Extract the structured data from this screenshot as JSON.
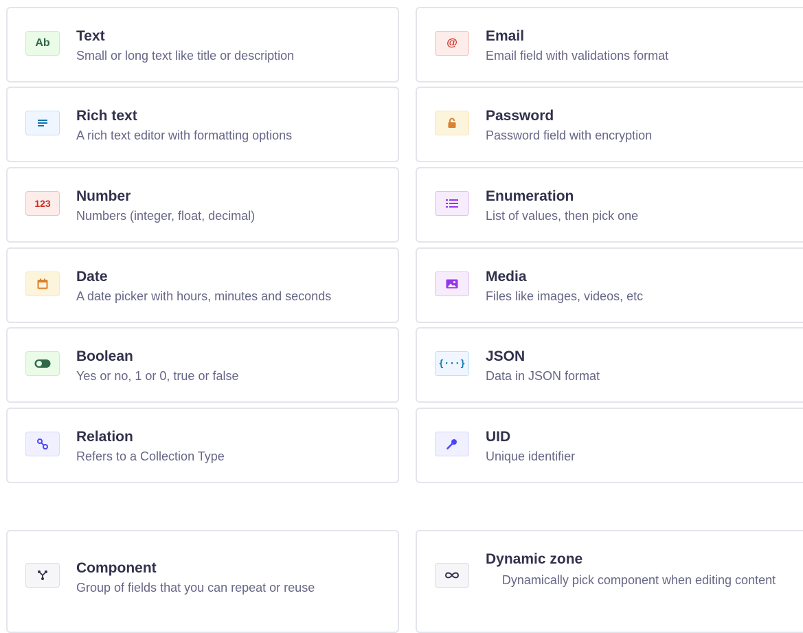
{
  "fields": [
    {
      "key": "text",
      "title": "Text",
      "description": "Small or long text like title or description",
      "icon_text": "Ab",
      "icon": "text-icon",
      "color": "#2f6846"
    },
    {
      "key": "email",
      "title": "Email",
      "description": "Email field with validations format",
      "icon_text": "@",
      "icon": "email-icon",
      "color": "#d02b20"
    },
    {
      "key": "rich-text",
      "title": "Rich text",
      "description": "A rich text editor with formatting options",
      "icon": "rich-text-icon",
      "color": "#0c75af"
    },
    {
      "key": "password",
      "title": "Password",
      "description": "Password field with encryption",
      "icon": "lock-icon",
      "color": "#d9822f"
    },
    {
      "key": "number",
      "title": "Number",
      "description": "Numbers (integer, float, decimal)",
      "icon_text": "123",
      "icon": "number-icon",
      "color": "#d02b20"
    },
    {
      "key": "enumeration",
      "title": "Enumeration",
      "description": "List of values, then pick one",
      "icon": "list-icon",
      "color": "#9736e8"
    },
    {
      "key": "date",
      "title": "Date",
      "description": "A date picker with hours, minutes and seconds",
      "icon": "calendar-icon",
      "color": "#d9822f"
    },
    {
      "key": "media",
      "title": "Media",
      "description": "Files like images, videos, etc",
      "icon": "media-icon",
      "color": "#9736e8"
    },
    {
      "key": "boolean",
      "title": "Boolean",
      "description": "Yes or no, 1 or 0, true or false",
      "icon": "toggle-icon",
      "color": "#2f6846"
    },
    {
      "key": "json",
      "title": "JSON",
      "description": "Data in JSON format",
      "icon_text": "{···}",
      "icon": "json-icon",
      "color": "#0c75af"
    },
    {
      "key": "relation",
      "title": "Relation",
      "description": "Refers to a Collection Type",
      "icon": "relation-icon",
      "color": "#4945ff"
    },
    {
      "key": "uid",
      "title": "UID",
      "description": "Unique identifier",
      "icon": "key-icon",
      "color": "#4945ff"
    }
  ],
  "custom": [
    {
      "key": "component",
      "title": "Component",
      "description": "Group of fields that you can repeat or reuse",
      "icon": "component-icon"
    },
    {
      "key": "dynamic-zone",
      "title": "Dynamic zone",
      "description": "Dynamically pick component when editing content",
      "icon": "infinity-icon"
    }
  ]
}
